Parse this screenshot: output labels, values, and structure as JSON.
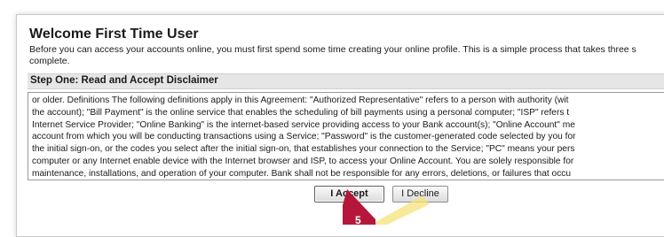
{
  "page": {
    "title": "Welcome First Time User",
    "intro_lines": [
      "Before you can access your accounts online, you must first spend some time creating your online profile. This is a simple process that takes three s",
      "complete."
    ]
  },
  "step": {
    "label": "Step One: Read and Accept Disclaimer"
  },
  "disclaimer": {
    "lines": [
      "or older. Definitions The following definitions apply in this Agreement: \"Authorized Representative\" refers to a person with authority (wit",
      "the account); \"Bill Payment\" is the online service that enables the scheduling of bill payments using a personal computer; \"ISP\" refers t",
      "Internet Service Provider; \"Online Banking\" is the internet-based service providing access to your Bank account(s); \"Online Account\" me",
      "account from which you will be conducting transactions using a Service; \"Password\" is the customer-generated code selected by you for",
      "the initial sign-on, or the codes you select after the initial sign-on, that establishes your connection to the Service; \"PC\" means your pers",
      "computer or any Internet enable device with the Internet browser and ISP, to access your Online Account. You are solely responsible for",
      "maintenance, installations, and operation of your computer. Bank shall not be responsible for any errors, deletions, or failures that occu"
    ]
  },
  "buttons": {
    "accept_label": "I Accept",
    "decline_label": "I Decline"
  },
  "overlay": {
    "cursor_icon": "pointer-arrow-icon",
    "highlight_icon": "click-highlight-icon",
    "arrow_color": "#b5173a",
    "highlight_color": "#f7e27a"
  }
}
